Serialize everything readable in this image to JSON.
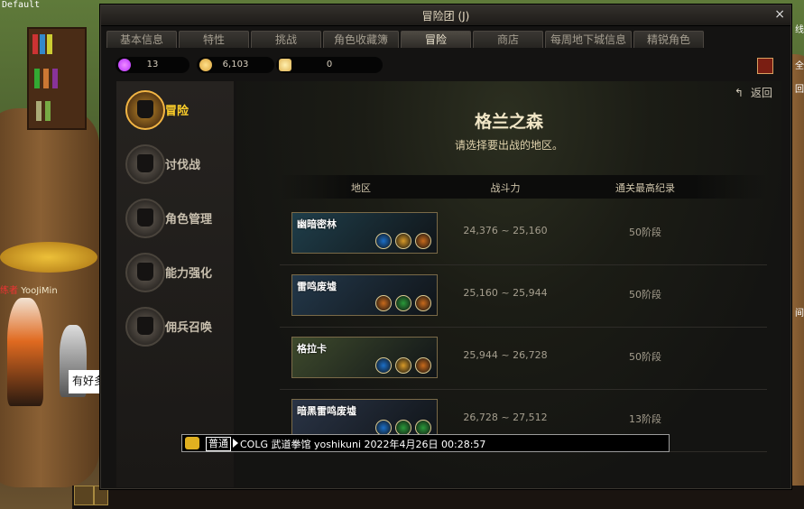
{
  "scene": {
    "corner_text": "Default",
    "player_name_prefix": "练者",
    "player_name": "YooJiMin",
    "speech_text": "有好多",
    "right_labels": [
      "线",
      "全",
      "回",
      "间"
    ]
  },
  "window": {
    "title": "冒险团 (J)",
    "close_symbol": "×",
    "tabs": [
      {
        "label": "基本信息",
        "active": false
      },
      {
        "label": "特性",
        "active": false
      },
      {
        "label": "挑战",
        "active": false
      },
      {
        "label": "角色收藏簿",
        "active": false
      },
      {
        "label": "冒险",
        "active": true
      },
      {
        "label": "商店",
        "active": false
      },
      {
        "label": "每周地下城信息",
        "active": false
      },
      {
        "label": "精锐角色",
        "active": false
      }
    ],
    "currencies": [
      {
        "name": "purple-gem-icon",
        "value": "13",
        "color": "#b52cff"
      },
      {
        "name": "gold-coin-icon",
        "value": "6,103",
        "color": "#d9a23a"
      },
      {
        "name": "gold-bar-icon",
        "value": "0",
        "color": "#e0b455"
      }
    ]
  },
  "sidebar": {
    "items": [
      {
        "label": "冒险",
        "icon": "adventure-shield-icon",
        "active": true
      },
      {
        "label": "讨伐战",
        "icon": "crossed-swords-icon",
        "active": false
      },
      {
        "label": "角色管理",
        "icon": "character-mask-icon",
        "active": false
      },
      {
        "label": "能力强化",
        "icon": "spiked-emblem-icon",
        "active": false
      },
      {
        "label": "佣兵召唤",
        "icon": "chest-icon",
        "active": false
      }
    ]
  },
  "main": {
    "back_symbol": "↰",
    "back_label": "返回",
    "region_title": "格兰之森",
    "subtitle": "请选择要出战的地区。",
    "columns": [
      "地区",
      "战斗力",
      "通关最高纪录"
    ],
    "rows": [
      {
        "name": "幽暗密林",
        "power": "24,376 ~ 25,160",
        "record": "50阶段",
        "bg": "#1f3e4a",
        "icons": [
          "#1c6fc8",
          "#d89a28",
          "#c86a1c"
        ]
      },
      {
        "name": "雷鸣废墟",
        "power": "25,160 ~ 25,944",
        "record": "50阶段",
        "bg": "#23384a",
        "icons": [
          "#c86a1c",
          "#2a9a3a",
          "#c86a1c"
        ]
      },
      {
        "name": "格拉卡",
        "power": "25,944 ~ 26,728",
        "record": "50阶段",
        "bg": "#3e4a2c",
        "icons": [
          "#1c6fc8",
          "#d89a28",
          "#c86a1c"
        ]
      },
      {
        "name": "暗黑雷鸣废墟",
        "power": "26,728 ~ 27,512",
        "record": "13阶段",
        "bg": "#2a3446",
        "icons": [
          "#1c6fc8",
          "#2a9a3a",
          "#2a9a3a"
        ]
      }
    ]
  },
  "chat": {
    "channel": "普通",
    "message": "COLG 武道拳馆 yoshikuni 2022年4月26日 00:28:57"
  }
}
